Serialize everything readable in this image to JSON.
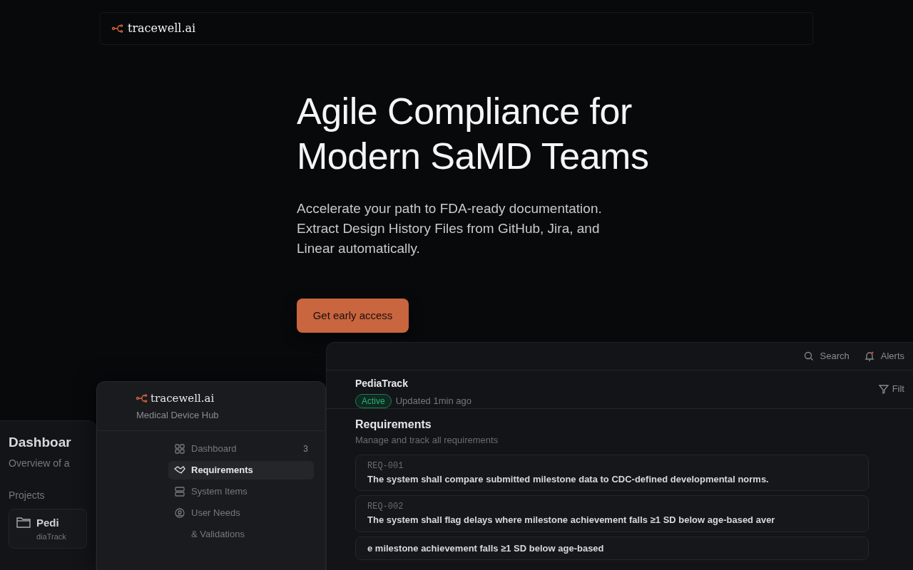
{
  "nav": {
    "brand": "tracewell.ai"
  },
  "hero": {
    "title_lines": [
      "Agile Compliance for",
      "Modern SaMD Teams"
    ],
    "subtitle_lines": [
      "Accelerate your path to FDA-ready documentation.",
      "Extract Design History Files from GitHub, Jira, and",
      "Linear automatically."
    ],
    "cta": "Get early access"
  },
  "app_preview": {
    "dashboard": {
      "title": "Dashboar",
      "subtitle": "Overview of a",
      "section": "Projects",
      "project": {
        "name": "Pedi",
        "sub": "diaTrack"
      }
    },
    "sidebar": {
      "brand": "tracewell.ai",
      "subtitle": "Medical Device Hub",
      "items": [
        {
          "label": "Dashboard",
          "selected": false,
          "count": "3"
        },
        {
          "label": "Requirements",
          "selected": true
        },
        {
          "label": "System Items",
          "selected": false
        },
        {
          "label": "User Needs",
          "selected": false
        },
        {
          "label": "& Validations",
          "selected": false
        }
      ]
    },
    "topbar": {
      "search": "Search",
      "alerts": "Alerts"
    },
    "project_header": {
      "name": "PediaTrack",
      "status": "Active",
      "updated": "Updated 1min ago",
      "filter": "Filt"
    },
    "section": {
      "title": "Requirements",
      "subtitle": "Manage and track all requirements"
    },
    "requirements": [
      {
        "id": "REQ-001",
        "text": "The system shall compare submitted milestone data to CDC-defined developmental norms."
      },
      {
        "id": "REQ-002",
        "text": "The system shall flag delays where milestone achievement falls ≥1 SD below age-based aver"
      },
      {
        "text": "e milestone achievement falls ≥1 SD below age-based"
      }
    ]
  }
}
